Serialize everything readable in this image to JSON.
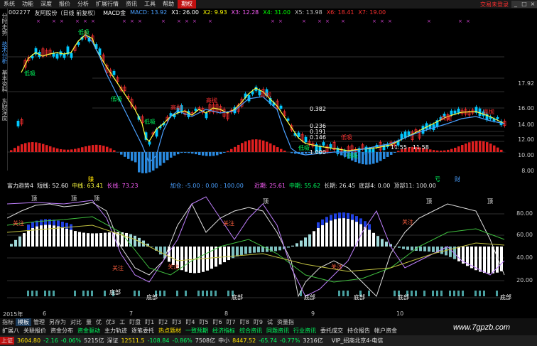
{
  "menubar": {
    "items": [
      "系统",
      "功能",
      "深度",
      "报价",
      "分析",
      "扩展行情",
      "资讯",
      "工具",
      "帮助",
      "期权"
    ],
    "active_index": 9,
    "promo": "交易未登录"
  },
  "sidebar": {
    "items": [
      "分时走势",
      "技术分析",
      "基本资料",
      "东财深度"
    ]
  },
  "info": {
    "code": "002277",
    "name": "友阿股份（日线 前复权）",
    "indicator": "MACD金",
    "macd": "MACD: 13.92",
    "x1": "X1: 26.00",
    "x2": "X2: 9.93",
    "x3": "X3: 12.28",
    "x4": "X4: 31.00",
    "x5": "X5: 13.98",
    "x6": "X6: 18.41",
    "x7": "X7: 19.00"
  },
  "main_chart": {
    "y_labels": [
      "17.92",
      "16.00",
      "14.00",
      "12.00",
      "10.00",
      "8.00"
    ],
    "fib_labels": [
      "0.382",
      "0.236",
      "0.191",
      "0.146",
      "1.000"
    ],
    "band_label": "11.55 - 11.58",
    "annotations": [
      "高抛",
      "高抛",
      "高抛",
      "高抛",
      "高抛",
      "低吸",
      "低吸",
      "低吸",
      "低吸",
      "低吸",
      "低吸",
      "低吸"
    ],
    "color_bull": "#ff3030",
    "color_bear": "#00c8ff"
  },
  "indicator2": {
    "title": "富力趋势4",
    "short": "短线: 52.60",
    "mid": "中线: 63.41",
    "long": "长线: 73.23",
    "add": "加仓: -5.00 : 0.00 : 100.00",
    "near": "近期: 25.61",
    "mid2": "中期: 55.62",
    "longp": "长期: 26.45",
    "bottom4": "底部4: 0.00",
    "top11": "顶部11: 100.00",
    "y_labels": [
      "80.00",
      "60.00",
      "40.00",
      "20.00"
    ],
    "tags_top": [
      "顶",
      "顶",
      "顶",
      "顶",
      "顶",
      "顶"
    ],
    "tags_bottom": [
      "底部",
      "底部",
      "底部",
      "底部",
      "底部",
      "底部",
      "底部"
    ],
    "tags_watch": [
      "关注",
      "关注",
      "关注",
      "关注",
      "关注",
      "关注"
    ],
    "bands_mid": [
      "赚",
      "亏",
      "财"
    ]
  },
  "xaxis": {
    "year": "2015年",
    "labels": [
      "6",
      "7",
      "8",
      "9",
      "10"
    ]
  },
  "tabs1": [
    "指标",
    "模板",
    "管理",
    "另存为",
    "对比",
    "量",
    "优",
    "优3",
    "工",
    "盯盘",
    "盯1",
    "盯2",
    "盯3",
    "盯4",
    "盯5",
    "盯6",
    "盯7",
    "盯8",
    "盯9",
    "试",
    "资量指"
  ],
  "tabs2": [
    {
      "label": "扩展八",
      "style": "normal"
    },
    {
      "label": "关联报价",
      "style": "normal"
    },
    {
      "label": "资金分布",
      "style": "normal"
    },
    {
      "label": "资金驱动",
      "style": "green"
    },
    {
      "label": "主力轨迹",
      "style": "normal"
    },
    {
      "label": "逐笔委托",
      "style": "normal"
    },
    {
      "label": "热点题材",
      "style": "yellow"
    },
    {
      "label": "一致预期",
      "style": "green"
    },
    {
      "label": "经济指标",
      "style": "green"
    },
    {
      "label": "综合资讯",
      "style": "green"
    },
    {
      "label": "同题资讯",
      "style": "green"
    },
    {
      "label": "行业资讯",
      "style": "green"
    },
    {
      "label": "委托成交",
      "style": "normal"
    },
    {
      "label": "持仓报告",
      "style": "normal"
    },
    {
      "label": "帐户资金",
      "style": "normal"
    }
  ],
  "statusbar": {
    "sh": "上证",
    "sh_val": "3604.80",
    "sh_chg": "-2.16",
    "sh_pct": "-0.06%",
    "sh_vol": "5215亿",
    "sz": "深证",
    "sz_val": "12511.5",
    "sz_chg": "-108.84",
    "sz_pct": "-0.86%",
    "sz_vol": "7508亿",
    "mid": "中小",
    "mid_val": "8447.52",
    "mid_chg": "-65.74",
    "mid_pct": "-0.77%",
    "mid_vol": "3216亿",
    "server": "VIP_招商北京4-电信"
  },
  "watermark": "www.7gpzb.com"
}
